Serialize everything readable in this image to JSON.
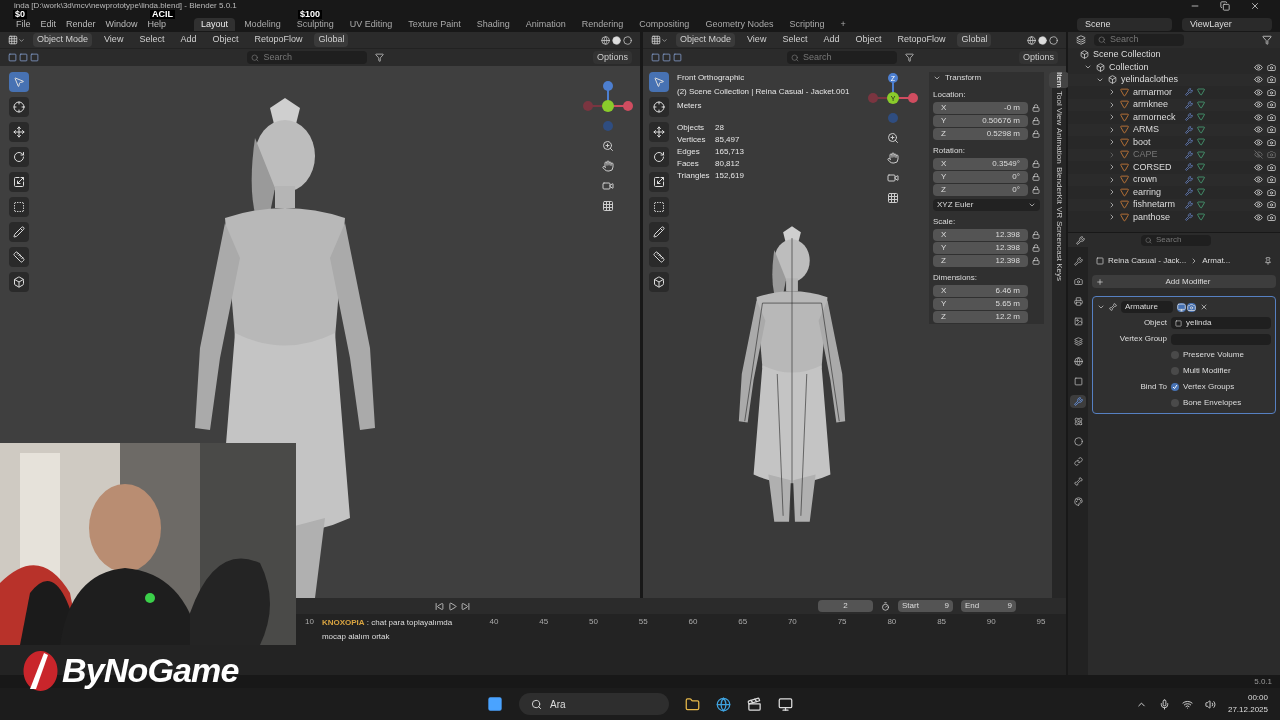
{
  "overlay": {
    "left": "$0",
    "center": "ACIL",
    "right": "$100"
  },
  "window": {
    "title": "inda [D:\\work\\3d\\mcv\\newprototype\\linda.blend] - Blender 5.0.1"
  },
  "menu": [
    "File",
    "Edit",
    "Render",
    "Window",
    "Help"
  ],
  "workspaces": [
    {
      "label": "Layout",
      "selected": true
    },
    {
      "label": "Modeling",
      "selected": false
    },
    {
      "label": "Sculpting",
      "selected": false
    },
    {
      "label": "UV Editing",
      "selected": false
    },
    {
      "label": "Texture Paint",
      "selected": false
    },
    {
      "label": "Shading",
      "selected": false
    },
    {
      "label": "Animation",
      "selected": false
    },
    {
      "label": "Rendering",
      "selected": false
    },
    {
      "label": "Compositing",
      "selected": false
    },
    {
      "label": "Geometry Nodes",
      "selected": false
    },
    {
      "label": "Scripting",
      "selected": false
    },
    {
      "label": "+",
      "selected": false
    }
  ],
  "scene": "Scene",
  "view_layer": "ViewLayer",
  "viewports": [
    {
      "mode": "Object Mode",
      "menus": [
        "View",
        "Select",
        "Add",
        "Object",
        "RetopoFlow"
      ],
      "orientation": "Global",
      "search_placeholder": "Search",
      "options": "Options",
      "tools": [
        {
          "kind": "select",
          "selected": true
        },
        {
          "kind": "cursor",
          "selected": false
        },
        {
          "kind": "move",
          "selected": false
        },
        {
          "kind": "rotate",
          "selected": false
        },
        {
          "kind": "scale",
          "selected": false
        },
        {
          "kind": "transform",
          "selected": false
        },
        {
          "kind": "annotate",
          "selected": false
        },
        {
          "kind": "measure",
          "selected": false
        },
        {
          "kind": "add",
          "selected": false
        }
      ]
    },
    {
      "mode": "Object Mode",
      "menus": [
        "View",
        "Select",
        "Add",
        "Object",
        "RetopoFlow"
      ],
      "orientation": "Global",
      "search_placeholder": "Search",
      "options": "Options",
      "gizmo": [
        "Z",
        "Y"
      ],
      "tools": [
        {
          "kind": "select",
          "selected": true
        },
        {
          "kind": "cursor",
          "selected": false
        },
        {
          "kind": "move",
          "selected": false
        },
        {
          "kind": "rotate",
          "selected": false
        },
        {
          "kind": "scale",
          "selected": false
        },
        {
          "kind": "transform",
          "selected": false
        },
        {
          "kind": "annotate",
          "selected": false
        },
        {
          "kind": "measure",
          "selected": false
        },
        {
          "kind": "add",
          "selected": false
        }
      ],
      "info": {
        "view": "Front Orthographic",
        "collection": "(2) Scene Collection | Reina Casual - Jacket.001",
        "units": "Meters",
        "stats": [
          {
            "label": "Objects",
            "value": "28"
          },
          {
            "label": "Vertices",
            "value": "85,497"
          },
          {
            "label": "Edges",
            "value": "165,713"
          },
          {
            "label": "Faces",
            "value": "80,812"
          },
          {
            "label": "Triangles",
            "value": "152,619"
          }
        ]
      }
    }
  ],
  "transform": {
    "title": "Transform",
    "groups": [
      {
        "label": "Location:",
        "rows": [
          {
            "axis": "X",
            "value": "-0 m"
          },
          {
            "axis": "Y",
            "value": "0.50676 m"
          },
          {
            "axis": "Z",
            "value": "0.5298 m"
          }
        ],
        "locks": true
      },
      {
        "label": "Rotation:",
        "rows": [
          {
            "axis": "X",
            "value": "0.3549°"
          },
          {
            "axis": "Y",
            "value": "0°"
          },
          {
            "axis": "Z",
            "value": "0°"
          }
        ],
        "locks": true,
        "mode": "XYZ Euler"
      },
      {
        "label": "Scale:",
        "rows": [
          {
            "axis": "X",
            "value": "12.398"
          },
          {
            "axis": "Y",
            "value": "12.398"
          },
          {
            "axis": "Z",
            "value": "12.398"
          }
        ],
        "locks": true
      },
      {
        "label": "Dimensions:",
        "rows": [
          {
            "axis": "X",
            "value": "6.46 m"
          },
          {
            "axis": "Y",
            "value": "5.65 m"
          },
          {
            "axis": "Z",
            "value": "12.2 m"
          }
        ],
        "locks": false
      }
    ]
  },
  "side_tabs": [
    {
      "label": "Item",
      "selected": true
    },
    {
      "label": "Tool",
      "selected": false
    },
    {
      "label": "View",
      "selected": false
    },
    {
      "label": "Animation",
      "selected": false
    },
    {
      "label": "BlenderKit",
      "selected": false
    },
    {
      "label": "VR",
      "selected": false
    },
    {
      "label": "Screencast Keys",
      "selected": false
    }
  ],
  "outliner": {
    "search_placeholder": "Search",
    "root": "Scene Collection",
    "tree": [
      {
        "name": "Collection",
        "kind": "collection",
        "expanded": true,
        "visible": true,
        "children": [
          {
            "name": "yelindaclothes",
            "kind": "collection",
            "expanded": true,
            "visible": true,
            "children": [
              {
                "name": "armarmor",
                "kind": "mesh",
                "expanded": false,
                "visible": true
              },
              {
                "name": "armknee",
                "kind": "mesh",
                "expanded": false,
                "visible": true
              },
              {
                "name": "armorneck",
                "kind": "mesh",
                "expanded": false,
                "visible": true
              },
              {
                "name": "ARMS",
                "kind": "mesh",
                "expanded": false,
                "visible": true
              },
              {
                "name": "boot",
                "kind": "mesh",
                "expanded": false,
                "visible": true
              },
              {
                "name": "CAPE",
                "kind": "mesh",
                "expanded": false,
                "visible": false
              },
              {
                "name": "CORSED",
                "kind": "mesh",
                "expanded": false,
                "visible": true
              },
              {
                "name": "crown",
                "kind": "mesh",
                "expanded": false,
                "visible": true
              },
              {
                "name": "earring",
                "kind": "mesh",
                "expanded": false,
                "visible": true
              },
              {
                "name": "fishnetarm",
                "kind": "mesh",
                "expanded": false,
                "visible": true
              },
              {
                "name": "panthose",
                "kind": "mesh",
                "expanded": false,
                "visible": true
              }
            ]
          }
        ]
      }
    ]
  },
  "properties": {
    "search_placeholder": "Search",
    "object": "Reina Casual - Jack...",
    "modifier_crumb": "Armat...",
    "add_modifier": "Add Modifier",
    "modifier": {
      "name": "Armature",
      "expanded": true,
      "object_label": "Object",
      "object": "yelinda",
      "vertex_group_label": "Vertex Group",
      "options": [
        {
          "label": "Preserve Volume",
          "checked": false
        },
        {
          "label": "Multi Modifier",
          "checked": false
        },
        {
          "group": "Bind To",
          "label": "Vertex Groups",
          "checked": true
        },
        {
          "label": "Bone Envelopes",
          "checked": false
        }
      ]
    },
    "tabs": [
      {
        "kind": "tool",
        "selected": false
      },
      {
        "kind": "render",
        "selected": false
      },
      {
        "kind": "output",
        "selected": false
      },
      {
        "kind": "view",
        "selected": false
      },
      {
        "kind": "scene",
        "selected": false
      },
      {
        "kind": "world",
        "selected": false
      },
      {
        "kind": "object",
        "selected": false
      },
      {
        "kind": "modifier",
        "selected": true
      },
      {
        "kind": "particles",
        "selected": false
      },
      {
        "kind": "physics",
        "selected": false
      },
      {
        "kind": "constraints",
        "selected": false
      },
      {
        "kind": "data",
        "selected": false
      },
      {
        "kind": "material",
        "selected": false
      }
    ]
  },
  "timeline": {
    "frame": "2",
    "start_label": "Start",
    "start": "9",
    "end_label": "End",
    "end": "9",
    "ruler_start": "10",
    "ticks": [
      "40",
      "45",
      "50",
      "55",
      "60",
      "65",
      "70",
      "75",
      "80",
      "85",
      "90",
      "95"
    ]
  },
  "chat": {
    "user": "KNOXOPIA",
    "message": ": chat para toplayalımda mocap alalım ortak"
  },
  "logo": "ByNoGame",
  "status": {
    "version": "5.0.1"
  },
  "taskbar": {
    "search_placeholder": "Ara",
    "time": "00:00",
    "date": "27.12.2025"
  }
}
